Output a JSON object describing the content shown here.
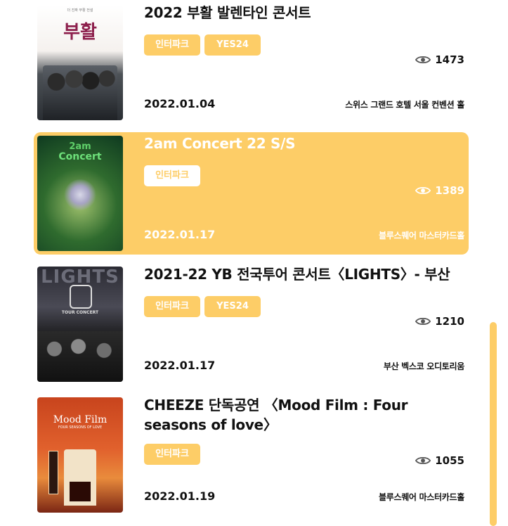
{
  "concerts": [
    {
      "title": "2022 부활 발렌타인 콘서트",
      "tags": [
        "인터파크",
        "YES24"
      ],
      "views": "1473",
      "date": "2022.01.04",
      "venue": "스위스 그랜드 호텔 서울 컨벤션 홀",
      "active": false,
      "poster": {
        "main": "부활",
        "sub": "더 진짜 부활 전설"
      }
    },
    {
      "title": "2am Concert 22 S/S",
      "tags": [
        "인터파크"
      ],
      "views": "1389",
      "date": "2022.01.17",
      "venue": "블루스퀘어 마스터카드홀",
      "active": true,
      "poster": {
        "main": "2am",
        "sub": "Concert"
      }
    },
    {
      "title": "2021-22 YB 전국투어 콘서트〈LIGHTS〉- 부산",
      "tags": [
        "인터파크",
        "YES24"
      ],
      "views": "1210",
      "date": "2022.01.17",
      "venue": "부산 벡스코 오디토리움",
      "active": false,
      "poster": {
        "main": "LIGHTS",
        "sub": "TOUR CONCERT"
      }
    },
    {
      "title": "CHEEZE 단독공연 〈Mood Film : Four seasons of love〉",
      "tags": [
        "인터파크"
      ],
      "views": "1055",
      "date": "2022.01.19",
      "venue": "블루스퀘어 마스터카드홀",
      "active": false,
      "poster": {
        "main": "Mood Film",
        "sub": "FOUR SEASONS OF LOVE"
      }
    }
  ],
  "colors": {
    "accent": "#fdcd67",
    "text": "#111111"
  },
  "icons": {
    "views": "eye-icon"
  }
}
